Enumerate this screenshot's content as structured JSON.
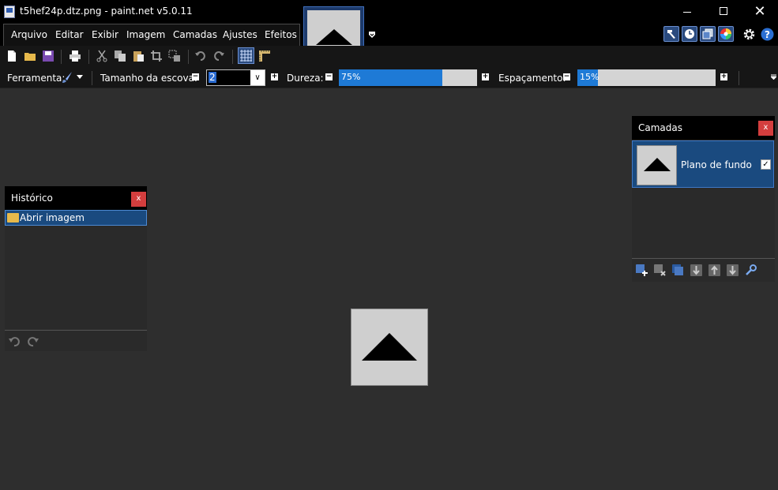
{
  "window": {
    "title": "t5hef24p.dtz.png - paint.net v5.0.11",
    "minimize_glyph": "",
    "close_glyph": "✕"
  },
  "menu": {
    "items": [
      "Arquivo",
      "Editar",
      "Exibir",
      "Imagem",
      "Camadas",
      "Ajustes",
      "Efeitos"
    ]
  },
  "toolbar": {
    "tool_label": "Ferramenta:",
    "brush_size_label": "Tamanho da escova:",
    "brush_size_value": "2",
    "hardness_label": "Dureza:",
    "hardness_value": "75%",
    "hardness_fraction": 0.75,
    "spacing_label": "Espaçamento:",
    "spacing_value": "15%",
    "spacing_fraction": 0.15
  },
  "history_panel": {
    "title": "Histórico",
    "close_label": "x",
    "items": [
      {
        "label": "Abrir imagem",
        "icon": "folder-icon"
      }
    ]
  },
  "layers_panel": {
    "title": "Camadas",
    "close_label": "x",
    "layers": [
      {
        "name": "Plano de fundo",
        "visible": true
      }
    ]
  },
  "colors": {
    "accent": "#1e7ad6",
    "selection": "#1a4a7f",
    "close_red": "#d43e3e"
  }
}
